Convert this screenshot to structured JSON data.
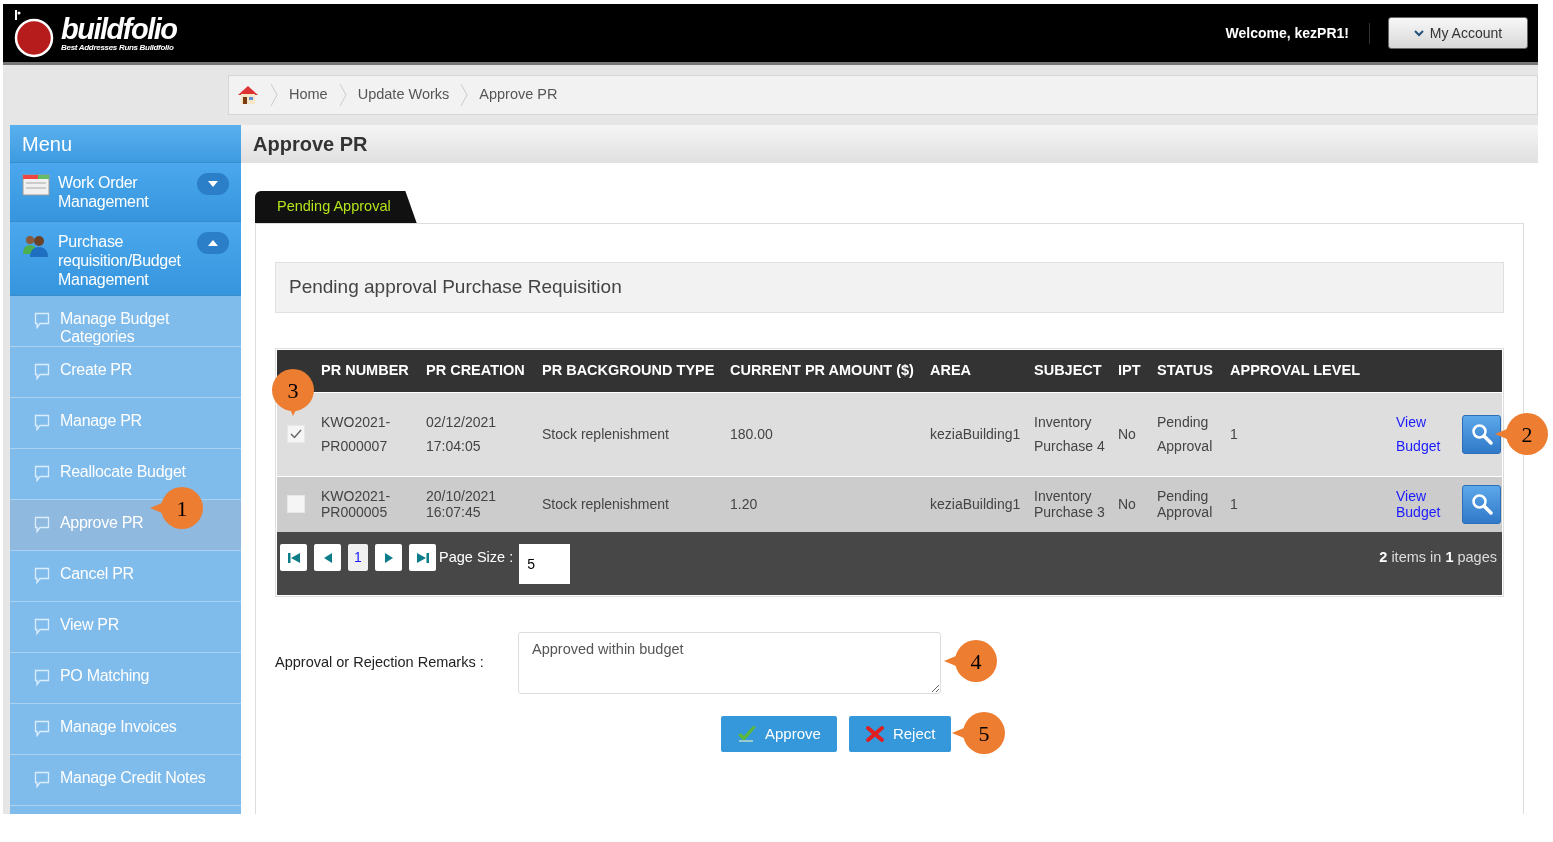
{
  "header": {
    "logo": "buildfolio",
    "tagline": "Best Addresses Runs Buildfolio",
    "welcome": "Welcome, kezPR1!",
    "account_button": "My Account"
  },
  "breadcrumb": [
    "Home",
    "Update Works",
    "Approve PR"
  ],
  "sidebar": {
    "title": "Menu",
    "sections": [
      {
        "label": "Work Order Management",
        "expanded": false
      },
      {
        "label": "Purchase requisition/Budget Management",
        "expanded": true,
        "children": [
          {
            "label": "Manage Budget Categories",
            "selected": false
          },
          {
            "label": "Create PR",
            "selected": false
          },
          {
            "label": "Manage PR",
            "selected": false
          },
          {
            "label": "Reallocate Budget",
            "selected": false
          },
          {
            "label": "Approve PR",
            "selected": true
          },
          {
            "label": "Cancel PR",
            "selected": false
          },
          {
            "label": "View PR",
            "selected": false
          },
          {
            "label": "PO Matching",
            "selected": false
          },
          {
            "label": "Manage Invoices",
            "selected": false
          },
          {
            "label": "Manage Credit Notes",
            "selected": false
          }
        ]
      }
    ]
  },
  "page_title": "Approve PR",
  "tabs": [
    {
      "label": "Pending Approval",
      "selected": true
    }
  ],
  "section_title": "Pending approval Purchase Requisition",
  "table": {
    "columns": [
      "PR NUMBER",
      "PR CREATION",
      "PR BACKGROUND TYPE",
      "CURRENT PR AMOUNT ($)",
      "AREA",
      "SUBJECT",
      "IPT",
      "STATUS",
      "APPROVAL LEVEL"
    ],
    "rows": [
      {
        "checked": true,
        "cells": [
          "KWO2021-PR000007",
          "02/12/2021 17:04:05",
          "Stock replenishment",
          "180.00",
          "keziaBuilding1",
          "Inventory Purchase 4",
          "No",
          "Pending Approval",
          "1"
        ],
        "link": "View Budget"
      },
      {
        "checked": false,
        "cells": [
          "KWO2021-PR000005",
          "20/10/2021 16:07:45",
          "Stock replenishment",
          "1.20",
          "keziaBuilding1",
          "Inventory Purchase 3",
          "No",
          "Pending Approval",
          "1"
        ],
        "link": "View Budget"
      }
    ],
    "pager": {
      "current_page": "1",
      "page_size_label": "Page Size :",
      "page_size": "5",
      "summary": "**2** items in **1** pages"
    }
  },
  "remarks": {
    "label": "Approval or Rejection Remarks :",
    "value": "Approved within budget"
  },
  "buttons": [
    {
      "label": "Approve",
      "kind": "approve"
    },
    {
      "label": "Reject",
      "kind": "reject"
    }
  ],
  "callouts": [
    "1",
    "2",
    "3",
    "4",
    "5"
  ]
}
